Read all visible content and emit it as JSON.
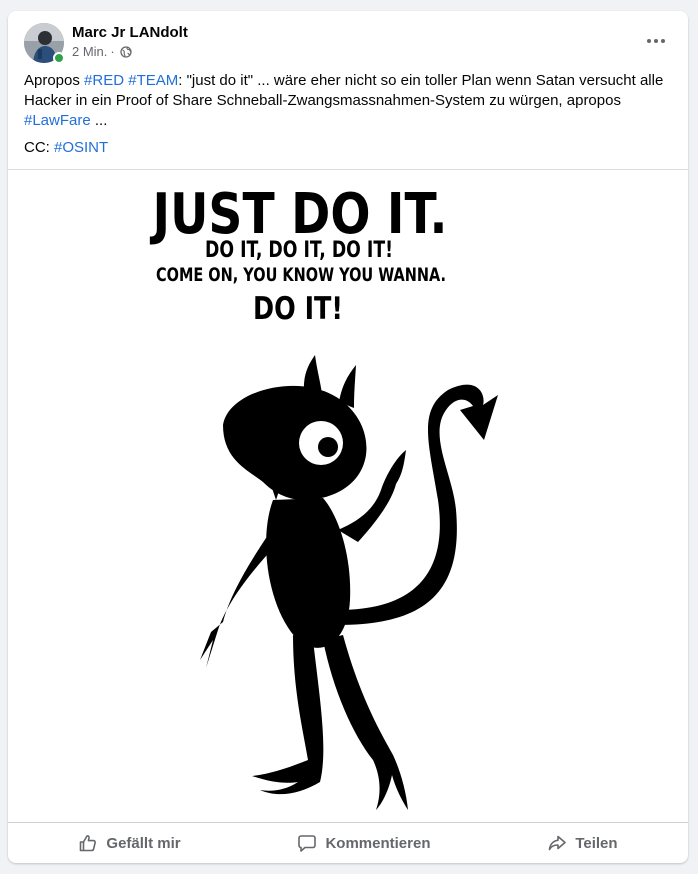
{
  "post": {
    "author": "Marc Jr LANdolt",
    "timestamp": "2 Min.",
    "separator": "·",
    "privacy_icon": "globe-icon",
    "more_icon": "more-options-icon",
    "text": {
      "line1_prefix": "Apropos ",
      "tag_red": "#RED",
      "space": " ",
      "tag_team": "#TEAM",
      "line1_middle": ": \"just do it\" ... wäre eher nicht so ein toller Plan wenn Satan versucht alle Hacker in ein Proof of Share Schneball-Zwangsmassnahmen-System zu würgen, apropos ",
      "tag_lawfare": "#LawFare",
      "line1_suffix": " ...",
      "cc_prefix": "CC: ",
      "tag_osint": "#OSINT"
    },
    "image": {
      "heading": "JUST DO IT.",
      "line2": "DO IT, DO IT, DO IT!",
      "line3": "COME ON, YOU KNOW YOU WANNA.",
      "line4": "DO IT!"
    }
  },
  "actions": {
    "like_label": "Gefällt mir",
    "comment_label": "Kommentieren",
    "share_label": "Teilen"
  },
  "colors": {
    "hashtag": "#216fdb",
    "secondary_text": "#65676b",
    "online": "#31a24c",
    "background": "#f0f2f5"
  }
}
